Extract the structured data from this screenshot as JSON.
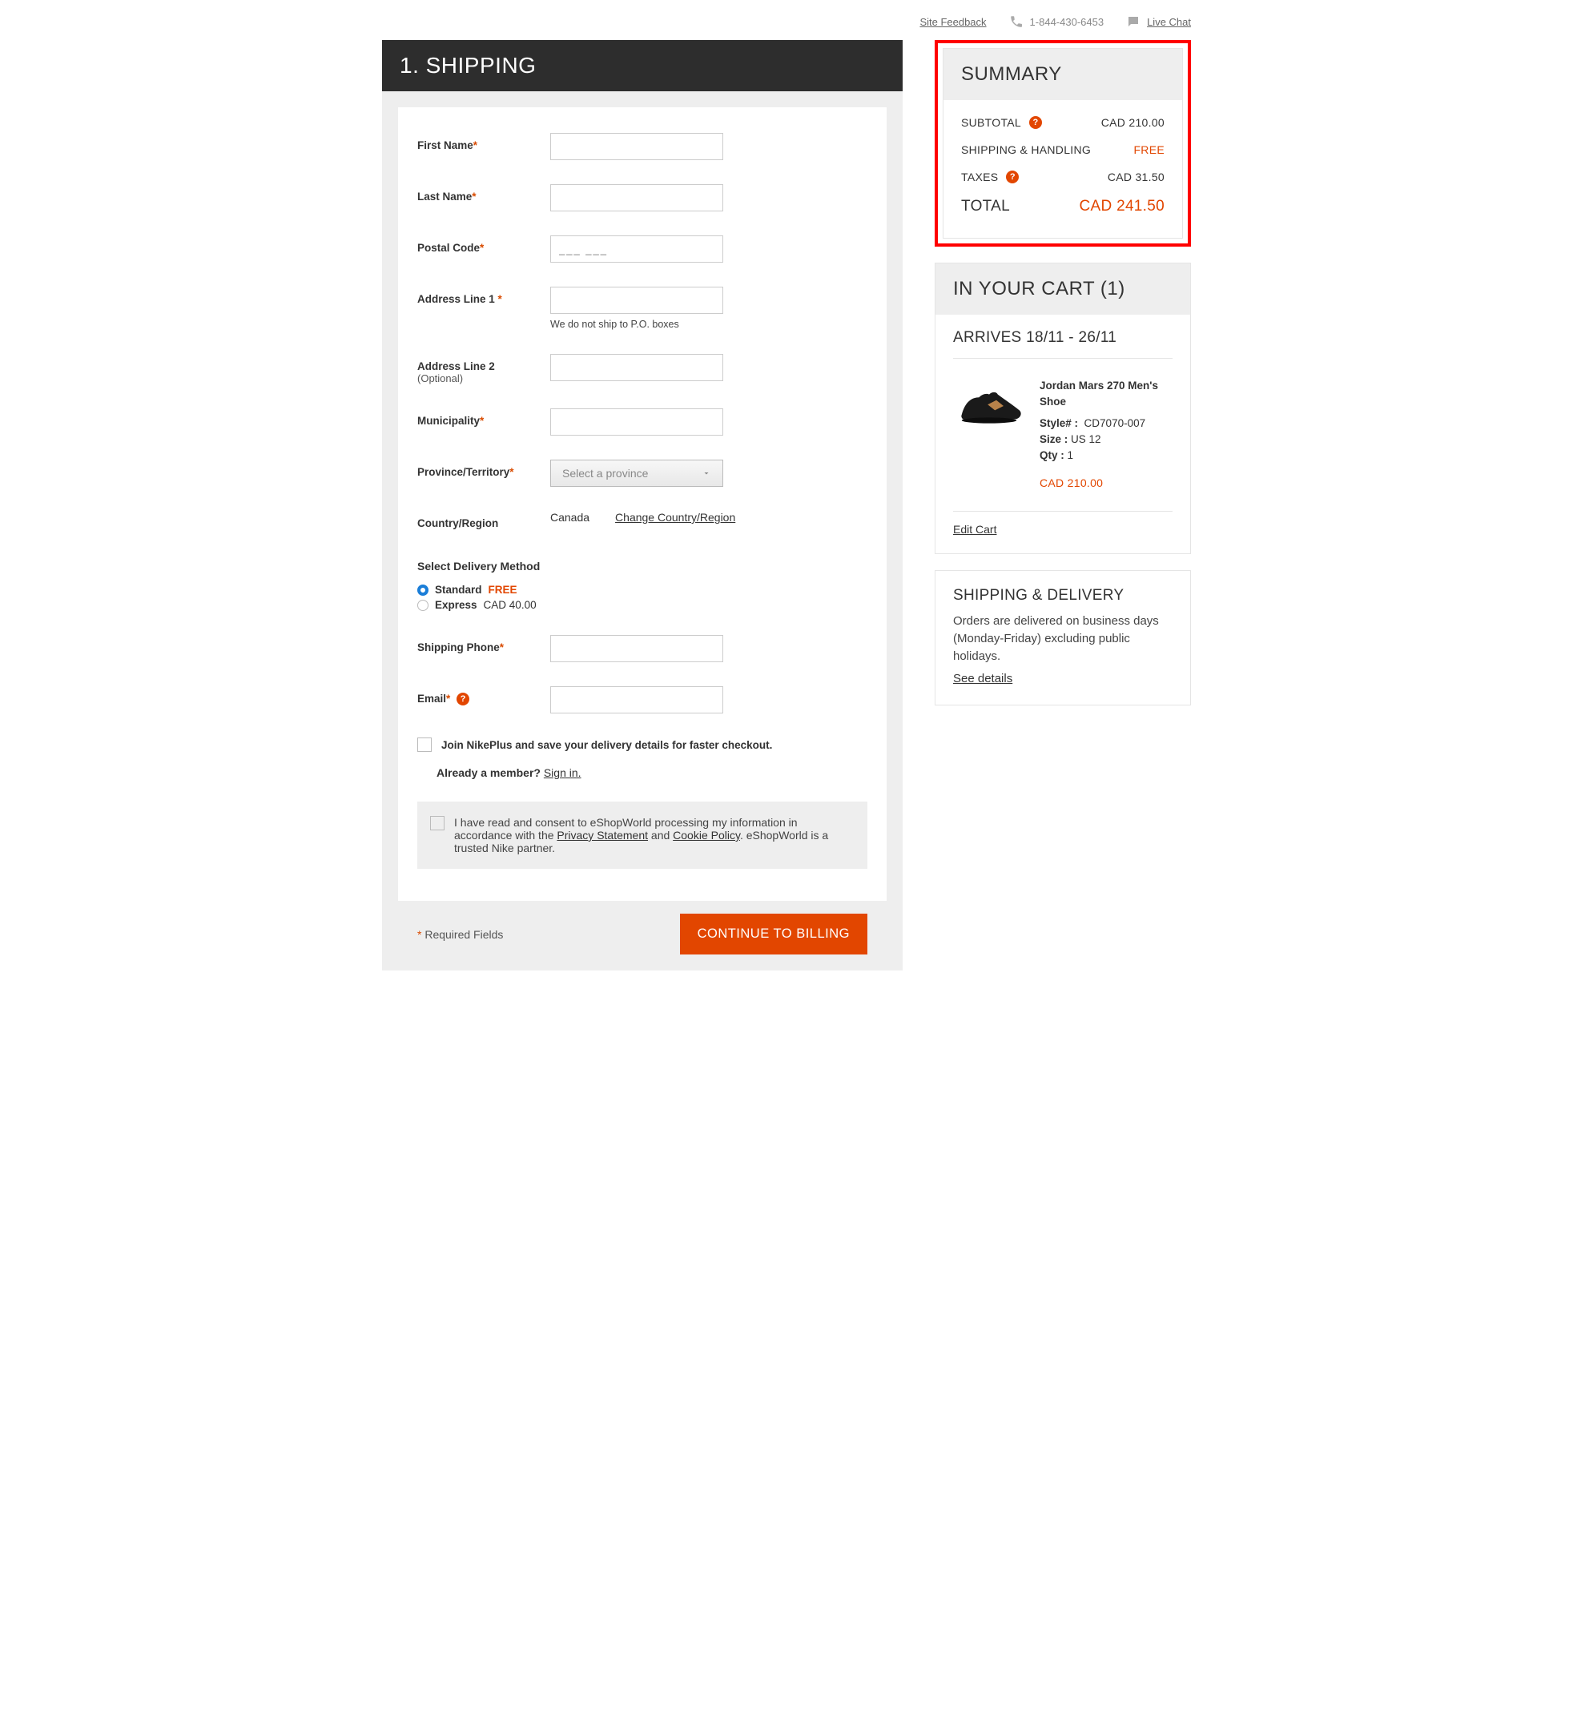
{
  "topbar": {
    "feedback": "Site Feedback",
    "phone": "1-844-430-6453",
    "chat": "Live Chat"
  },
  "section_title": "1. SHIPPING",
  "labels": {
    "first_name": "First Name",
    "last_name": "Last Name",
    "postal_code": "Postal Code",
    "addr1": "Address Line 1 ",
    "addr1_helper": "We do not ship to P.O. boxes",
    "addr2": "Address Line 2",
    "addr2_opt": "(Optional)",
    "municipality": "Municipality",
    "province": "Province/Territory",
    "province_placeholder": "Select a province",
    "country_lbl": "Country/Region",
    "country_val": "Canada",
    "country_link": "Change Country/Region",
    "deliv_title": "Select Delivery Method",
    "std": "Standard",
    "std_price": "FREE",
    "exp": "Express",
    "exp_price": "CAD 40.00",
    "ship_phone": "Shipping Phone",
    "email": "Email",
    "join": "Join NikePlus and save your delivery details for faster checkout.",
    "member_q": "Already a member?",
    "signin": "Sign in.",
    "consent_pre": "I have read and consent to eShopWorld processing my information in accordance with the ",
    "privacy": "Privacy Statement",
    "consent_and": " and ",
    "cookie": "Cookie Policy",
    "consent_post": ". eShopWorld is a trusted Nike partner.",
    "required_fields": " Required Fields",
    "continue": "CONTINUE TO BILLING",
    "postal_placeholder": "___ ___"
  },
  "summary": {
    "title": "SUMMARY",
    "subtotal_lbl": "SUBTOTAL",
    "subtotal_val": "CAD 210.00",
    "ship_lbl": "SHIPPING & HANDLING",
    "ship_val": "FREE",
    "tax_lbl": "TAXES",
    "tax_val": "CAD 31.50",
    "total_lbl": "TOTAL",
    "total_val": "CAD 241.50"
  },
  "cart": {
    "title": "IN YOUR CART (1)",
    "arrives": "ARRIVES 18/11 - 26/11",
    "item_name": "Jordan Mars 270 Men's Shoe",
    "style_lbl": "Style# :",
    "style_val": "CD7070-007",
    "size_lbl": "Size :",
    "size_val": "US 12",
    "qty_lbl": "Qty :",
    "qty_val": "1",
    "price": "CAD 210.00",
    "edit": "Edit Cart"
  },
  "delivery": {
    "title": "SHIPPING & DELIVERY",
    "text": "Orders are delivered on business days (Monday-Friday) excluding public holidays.",
    "link": "See details"
  }
}
